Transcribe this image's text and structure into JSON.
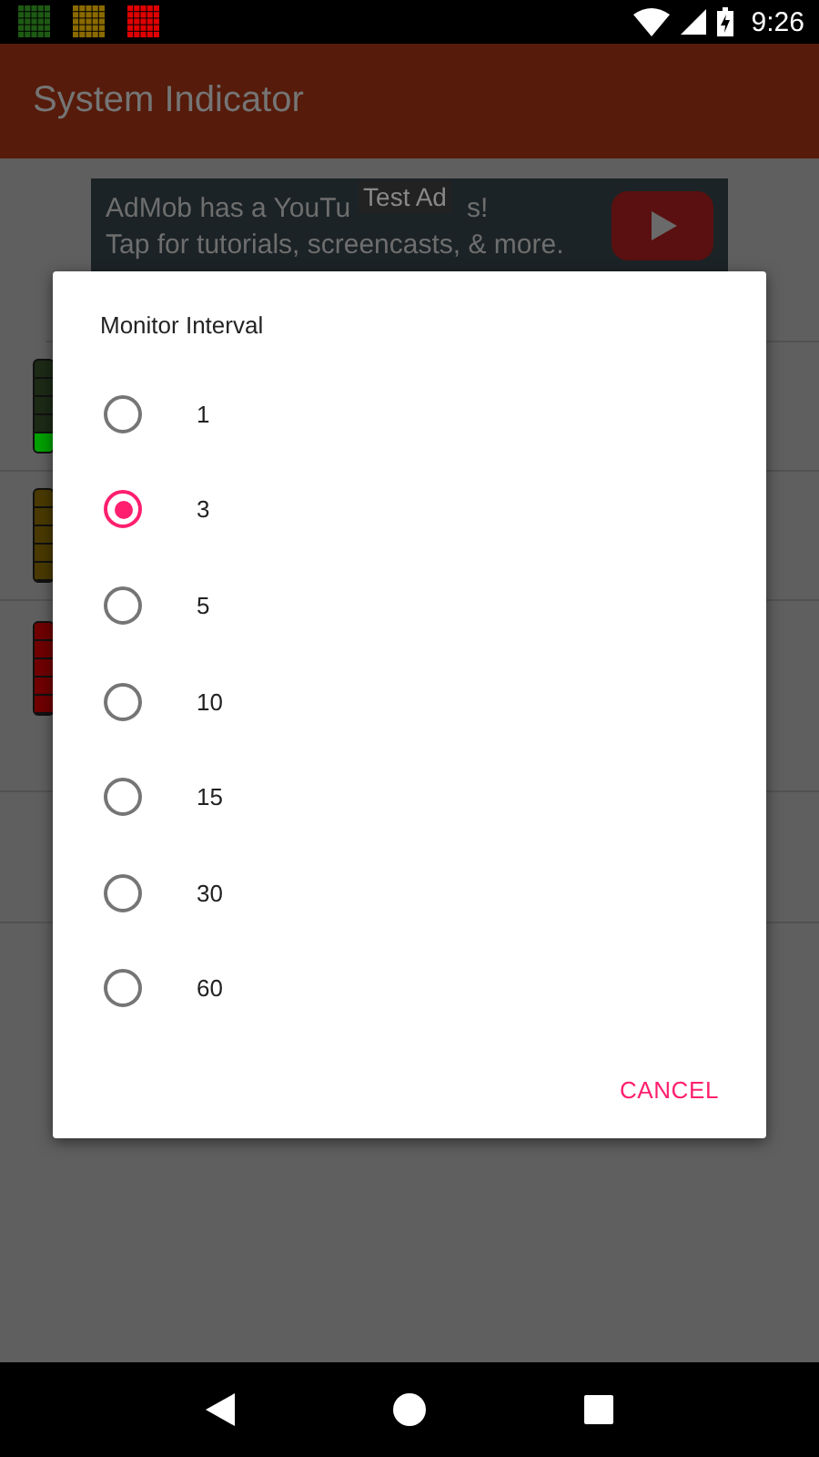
{
  "status_bar": {
    "indicators": [
      {
        "color": "#1e5a14"
      },
      {
        "color": "#8a6a00"
      },
      {
        "color": "#e00000"
      }
    ],
    "time": "9:26"
  },
  "app_bar": {
    "title": "System Indicator"
  },
  "ad": {
    "line_1_start": "AdMob has a YouTu",
    "line_1_end": "s!",
    "line_2": "Tap for tutorials, screencasts, & more.",
    "badge": "Test Ad"
  },
  "meters": [
    {
      "color": "#1c2a16",
      "level": 0.2
    },
    {
      "color": "#4a3a00"
    },
    {
      "color": "#700000"
    }
  ],
  "dialog": {
    "title": "Monitor Interval",
    "options": [
      {
        "label": "1",
        "selected": false
      },
      {
        "label": "3",
        "selected": true
      },
      {
        "label": "5",
        "selected": false
      },
      {
        "label": "10",
        "selected": false
      },
      {
        "label": "15",
        "selected": false
      },
      {
        "label": "30",
        "selected": false
      },
      {
        "label": "60",
        "selected": false
      }
    ],
    "buttons": [
      "CANCEL"
    ]
  }
}
